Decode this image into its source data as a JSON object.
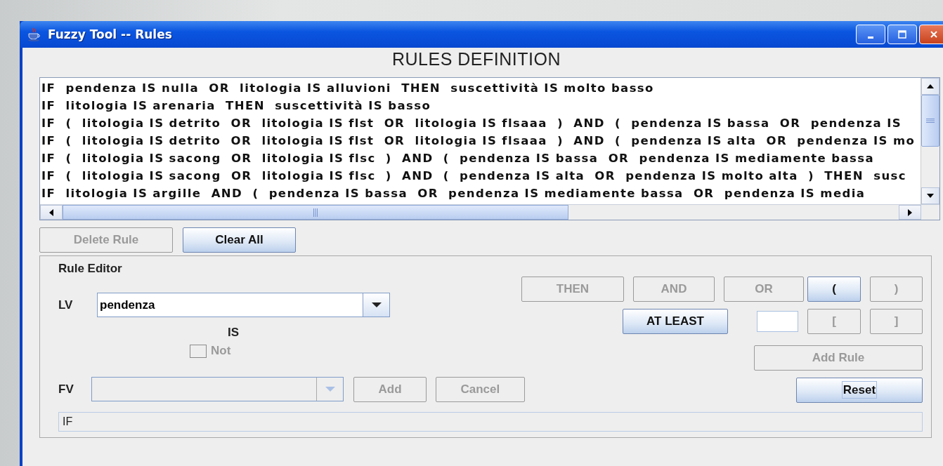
{
  "window": {
    "title": "Fuzzy Tool -- Rules"
  },
  "heading": "RULES DEFINITION",
  "rules": [
    "IF  pendenza IS nulla  OR  litologia IS alluvioni  THEN  suscettività IS molto basso",
    "IF  litologia IS arenaria  THEN  suscettività IS basso",
    "IF  (  litologia IS detrito  OR  litologia IS flst  OR  litologia IS flsaaa  )  AND  (  pendenza IS bassa  OR  pendenza IS",
    "IF  (  litologia IS detrito  OR  litologia IS flst  OR  litologia IS flsaaa  )  AND  (  pendenza IS alta  OR  pendenza IS mo",
    "IF  (  litologia IS sacong  OR  litologia IS flsc  )  AND  (  pendenza IS bassa  OR  pendenza IS mediamente bassa",
    "IF  (  litologia IS sacong  OR  litologia IS flsc  )  AND  (  pendenza IS alta  OR  pendenza IS molto alta  )  THEN  susc",
    "IF  litologia IS argille  AND  (  pendenza IS bassa  OR  pendenza IS mediamente bassa  OR  pendenza IS media"
  ],
  "list_buttons": [
    {
      "label": "Delete Rule",
      "disabled": true
    },
    {
      "label": "Clear All",
      "disabled": false
    }
  ],
  "rule_editor": {
    "title": "Rule Editor",
    "lv": {
      "label": "LV",
      "value": "pendenza",
      "disabled": false
    },
    "is_label": "IS",
    "not": {
      "label": "Not",
      "checked": false,
      "disabled": true
    },
    "fv": {
      "label": "FV",
      "disabled": true
    },
    "fv_buttons": [
      {
        "label": "Add",
        "disabled": true
      },
      {
        "label": "Cancel",
        "disabled": true
      }
    ],
    "operators": [
      {
        "kind": "button",
        "label": "THEN",
        "disabled": true
      },
      {
        "kind": "button",
        "label": "AND",
        "disabled": true
      },
      {
        "kind": "button",
        "label": "OR",
        "disabled": true
      },
      {
        "kind": "button",
        "label": "(",
        "disabled": false
      },
      {
        "kind": "button",
        "label": ")",
        "disabled": true
      }
    ],
    "operators_2": [
      {
        "kind": "button",
        "label": "AT LEAST",
        "disabled": false
      },
      {
        "kind": "field"
      },
      {
        "kind": "button",
        "label": "[",
        "disabled": true
      },
      {
        "kind": "button",
        "label": "]",
        "disabled": true
      }
    ],
    "add_rule": {
      "label": "Add Rule",
      "disabled": true
    },
    "reset": {
      "label": "Reset",
      "disabled": false,
      "focused": true
    },
    "expression": "IF"
  }
}
